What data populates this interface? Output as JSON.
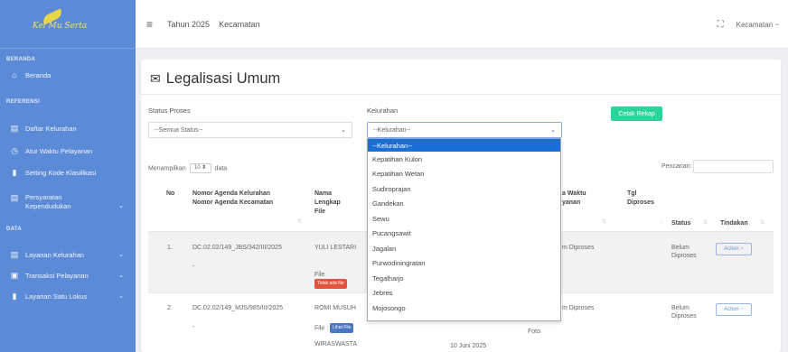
{
  "sidebar": {
    "logo_text": "Kel Mu Serta",
    "sections": {
      "beranda": "BERANDA",
      "referensi": "REFERENSI",
      "data": "DATA"
    },
    "items": [
      {
        "label": "Beranda",
        "icon": "home-icon"
      },
      {
        "label": "Daftar Kelurahan",
        "icon": "list-icon"
      },
      {
        "label": "Atur Waktu Pelayanan",
        "icon": "clock-icon"
      },
      {
        "label": "Setting Kode Klasifikasi",
        "icon": "file-icon"
      },
      {
        "label": "Persyaratan Kependudukan",
        "icon": "list-icon"
      },
      {
        "label": "Layanan Kelurahan",
        "icon": "list-icon"
      },
      {
        "label": "Transaksi Pelayanan",
        "icon": "card-icon"
      },
      {
        "label": "Layanan Satu Lokus",
        "icon": "book-icon"
      }
    ]
  },
  "topbar": {
    "year": "Tahun 2025",
    "area": "Kecamatan",
    "user": "Kecamatan ~"
  },
  "page": {
    "title": "Legalisasi Umum",
    "status_label": "Status Proses",
    "status_value": "--Semua Status--",
    "kelurahan_label": "Kelurahan",
    "kelurahan_value": "--Kelurahan--",
    "print_button": "Cetak Rekap",
    "show_prefix": "Menampilkan",
    "show_count": "10",
    "show_suffix": "data",
    "search_label": "Pencarian:"
  },
  "table": {
    "headers": {
      "no": "No",
      "agenda_line1": "Nomor Agenda Kelurahan",
      "agenda_line2": "Nomor Agenda Kecamatan",
      "nama_line1": "Nama",
      "nama_line2": "Lengkap",
      "nama_line3": "File",
      "waktu_line1": "a Waktu",
      "waktu_line2": "yanan",
      "tgl_line1": "Tgl",
      "tgl_line2": "Diproses",
      "status": "Status",
      "tindakan": "Tindakan"
    },
    "rows": [
      {
        "no": "1.",
        "agenda_kel": "DC.02.02/149_JBS/342/III/2025",
        "agenda_kec": "-",
        "nama": "YULI LESTARI",
        "file_label": "File",
        "file_badge": "Tidak ada file",
        "waktu": "m Diproses",
        "status_line1": "Belum",
        "status_line2": "Diproses",
        "action": "Action ~"
      },
      {
        "no": "2.",
        "agenda_kel": "DC.02.02/149_MJS/985/III/2025",
        "agenda_kec": "-",
        "nama": "ROMI MUSUH",
        "file_label": "File :",
        "file_badge": "Lihat File",
        "pekerjaan": "WIRASWASTA",
        "foto": "Foto",
        "tanggal": "10 Juni 2025",
        "waktu": "m Diproses",
        "status_line1": "Belum",
        "status_line2": "Diproses",
        "action": "Action ~"
      }
    ]
  },
  "dropdown": {
    "options": [
      "--Kelurahan--",
      "Kepatihan Kulon",
      "Kepatihan Wetan",
      "Sudiroprajan",
      "Gandekan",
      "Sewu",
      "Pucangsawit",
      "Jagalan",
      "Purwodiningratan",
      "Tegalharjo",
      "Jebres",
      "Mojosongo"
    ],
    "selected_index": 0
  },
  "colors": {
    "sidebar": "#5b8ad6",
    "accent_green": "#2dd49a",
    "selected_option": "#1a6fd6"
  }
}
